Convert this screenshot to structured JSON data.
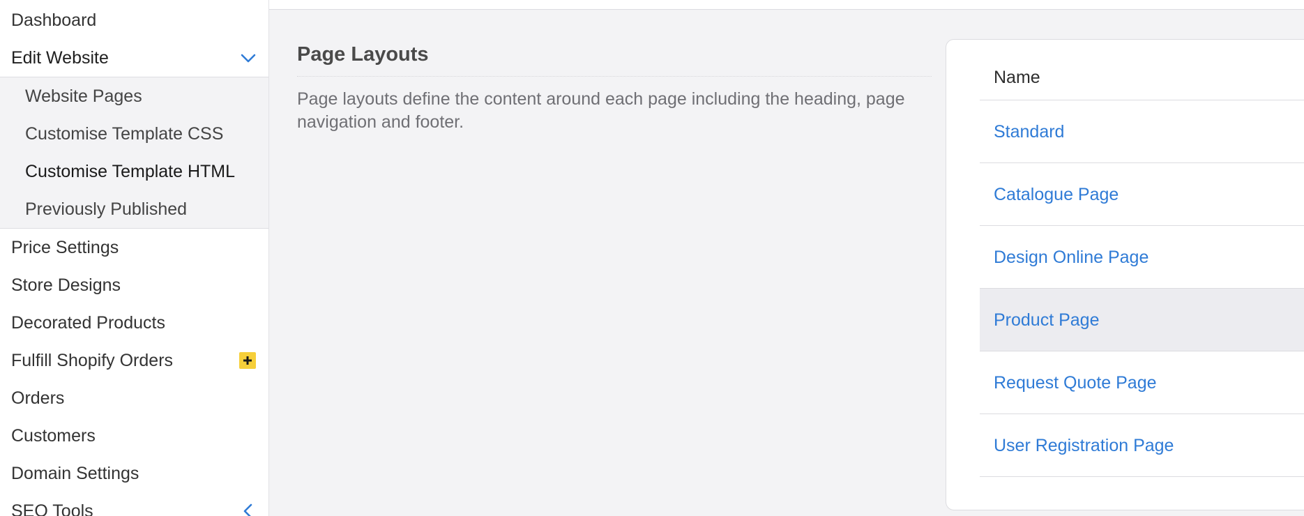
{
  "sidebar": {
    "items_top": [
      {
        "label": "Dashboard"
      },
      {
        "label": "Edit Website"
      }
    ],
    "submenu": [
      {
        "label": "Website Pages"
      },
      {
        "label": "Customise Template CSS"
      },
      {
        "label": "Customise Template HTML"
      },
      {
        "label": "Previously Published"
      }
    ],
    "items_bottom": [
      {
        "label": "Price Settings"
      },
      {
        "label": "Store Designs"
      },
      {
        "label": "Decorated Products"
      },
      {
        "label": "Fulfill Shopify Orders"
      },
      {
        "label": "Orders"
      },
      {
        "label": "Customers"
      },
      {
        "label": "Domain Settings"
      },
      {
        "label": "SEO Tools"
      }
    ],
    "accent_color": "#2f7bd6",
    "badge_color": "#f6cf3a"
  },
  "intro": {
    "title": "Page Layouts",
    "description": "Page layouts define the content around each page including the heading, page navigation and footer."
  },
  "layouts_table": {
    "header": "Name",
    "rows": [
      {
        "name": "Standard"
      },
      {
        "name": "Catalogue Page"
      },
      {
        "name": "Design Online Page"
      },
      {
        "name": "Product Page"
      },
      {
        "name": "Request Quote Page"
      },
      {
        "name": "User Registration Page"
      }
    ]
  }
}
